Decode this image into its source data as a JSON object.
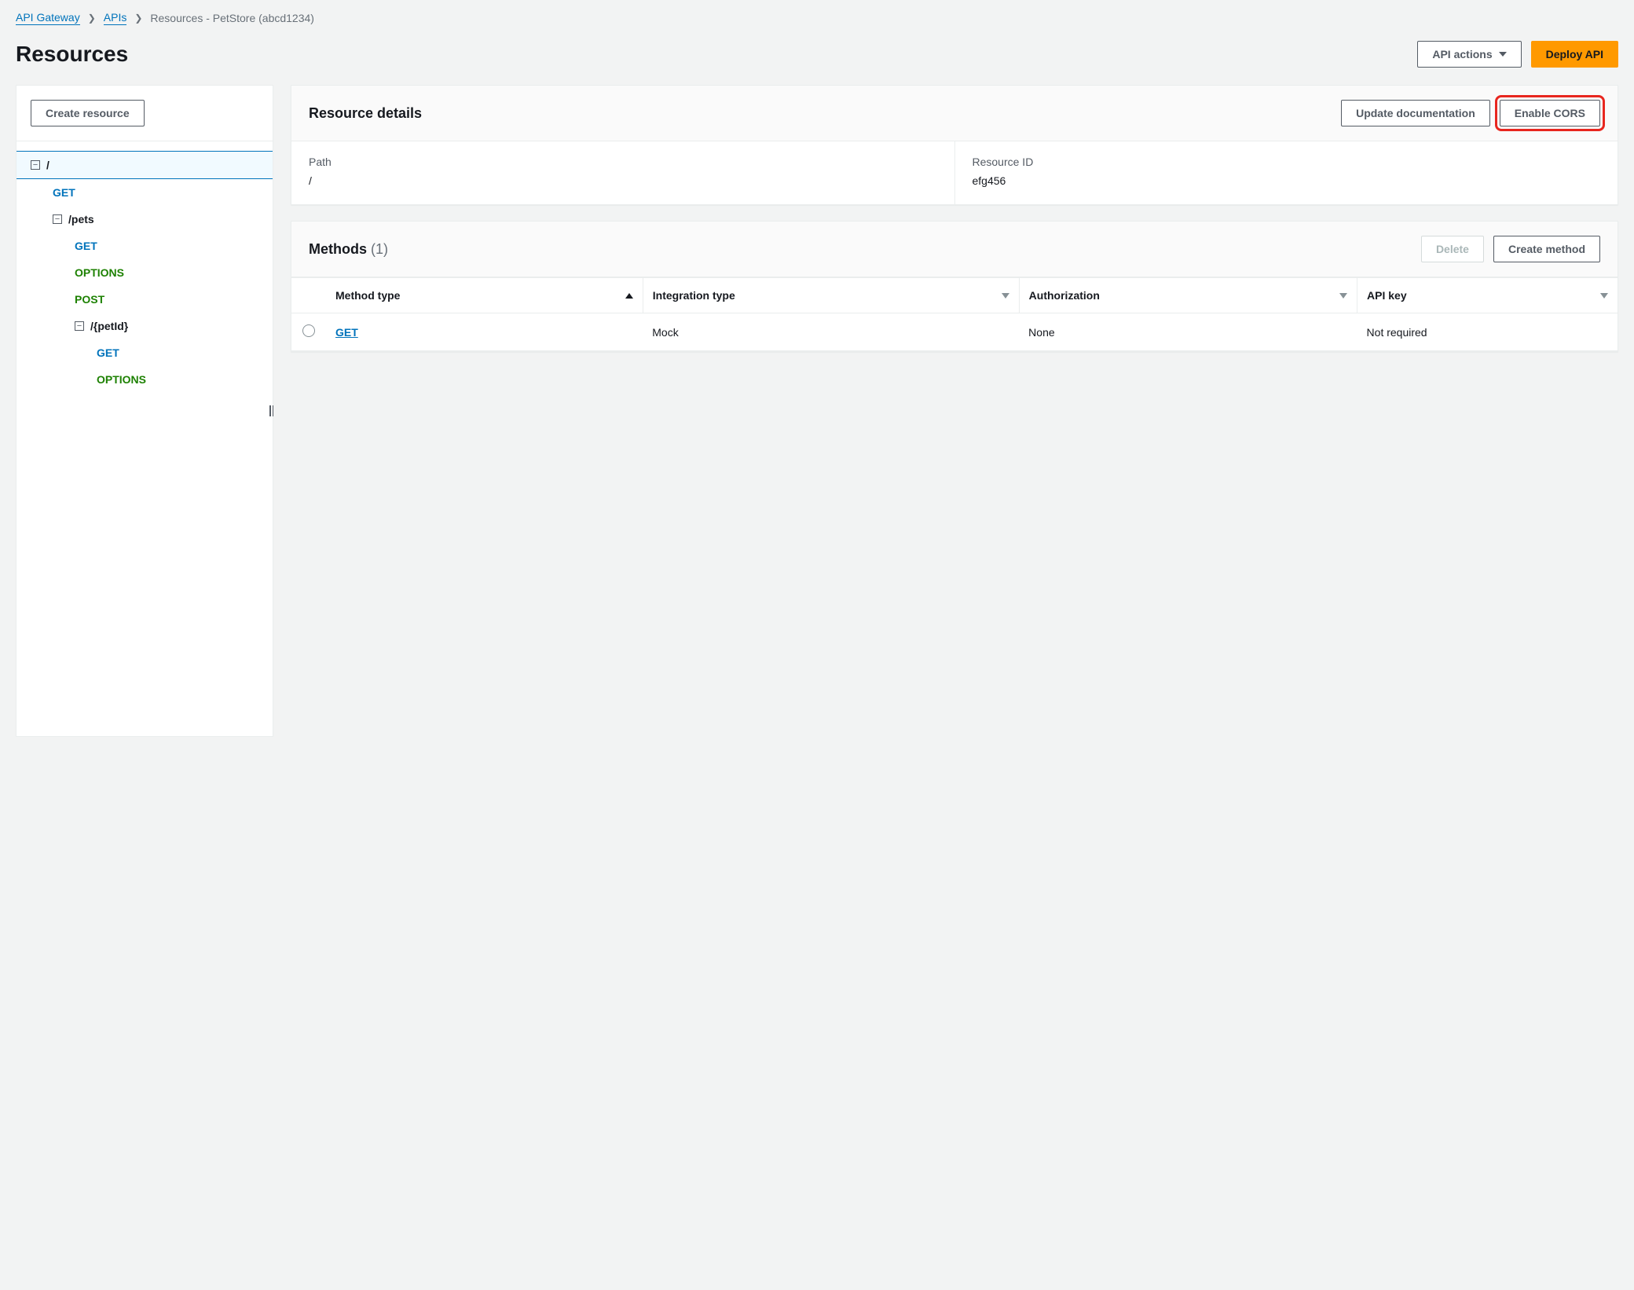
{
  "breadcrumb": {
    "items": [
      "API Gateway",
      "APIs"
    ],
    "current": "Resources - PetStore (abcd1234)"
  },
  "header": {
    "title": "Resources",
    "api_actions_label": "API actions",
    "deploy_label": "Deploy API"
  },
  "sidebar": {
    "create_resource_label": "Create resource",
    "tree": {
      "root": "/",
      "root_methods": [
        "GET"
      ],
      "pets": "/pets",
      "pets_methods": [
        "GET",
        "OPTIONS",
        "POST"
      ],
      "petid": "/{petId}",
      "petid_methods": [
        "GET",
        "OPTIONS"
      ]
    }
  },
  "resource_details": {
    "panel_title": "Resource details",
    "update_doc_label": "Update documentation",
    "enable_cors_label": "Enable CORS",
    "path_label": "Path",
    "path_value": "/",
    "resource_id_label": "Resource ID",
    "resource_id_value": "efg456"
  },
  "methods": {
    "panel_title": "Methods",
    "count": "(1)",
    "delete_label": "Delete",
    "create_method_label": "Create method",
    "columns": {
      "method_type": "Method type",
      "integration_type": "Integration type",
      "authorization": "Authorization",
      "api_key": "API key"
    },
    "rows": [
      {
        "method_type": "GET",
        "integration_type": "Mock",
        "authorization": "None",
        "api_key": "Not required"
      }
    ]
  }
}
